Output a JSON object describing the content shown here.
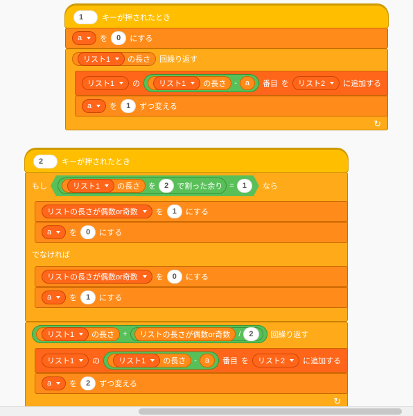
{
  "colors": {
    "events": "#ffbf00",
    "control": "#ffab19",
    "data": "#ff8c1a",
    "data_dark": "#ff661a",
    "operator": "#59c059"
  },
  "hat_key_pressed_suffix": "キーが押されたとき",
  "words": {
    "set_mid": "を",
    "set_end": "にする",
    "length_suffix": "の長さ",
    "repeat_suffix": "回繰り返す",
    "of": "の",
    "index_suffix": "番目",
    "add_to_suffix": "に追加する",
    "change_mid": "を",
    "change_end": "ずつ変える",
    "if": "もし",
    "then": "なら",
    "else": "でなければ",
    "mod_suffix": "で割った余り",
    "equals": "=",
    "minus": "-",
    "plus": "+",
    "divide": "/"
  },
  "script1": {
    "key": "1",
    "setA": {
      "var": "a",
      "value": "0"
    },
    "repeat_count": {
      "list": "リスト1"
    },
    "insert": {
      "target_list": "リスト1",
      "index_expr": {
        "list": "リスト1",
        "minus_var": "a"
      },
      "dest_list": "リスト2"
    },
    "changeA": {
      "var": "a",
      "by": "1"
    }
  },
  "script2": {
    "key": "2",
    "if_cond": {
      "mod": {
        "list": "リスト1",
        "divisor": "2"
      },
      "equals": "1"
    },
    "then": {
      "set_parity": {
        "var": "リストの長さが偶数or奇数",
        "value": "1"
      },
      "setA": {
        "var": "a",
        "value": "0"
      }
    },
    "else": {
      "set_parity": {
        "var": "リストの長さが偶数or奇数",
        "value": "0"
      },
      "setA": {
        "var": "a",
        "value": "1"
      }
    },
    "repeat_count": {
      "sum": {
        "left_list": "リスト1",
        "right_div": {
          "var": "リストの長さが偶数or奇数",
          "divisor": "2"
        }
      }
    },
    "insert": {
      "target_list": "リスト1",
      "index_expr": {
        "list": "リスト1",
        "minus_var": "a"
      },
      "dest_list": "リスト2"
    },
    "changeA": {
      "var": "a",
      "by": "2"
    }
  }
}
